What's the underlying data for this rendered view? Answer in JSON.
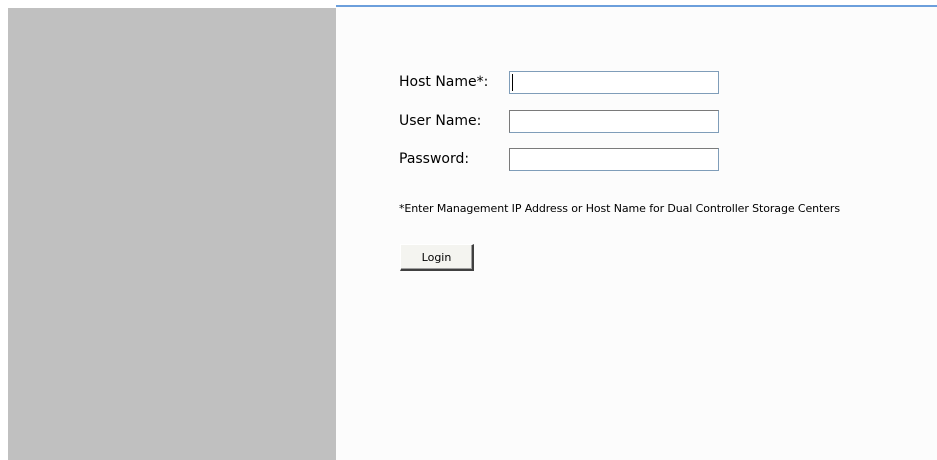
{
  "login_form": {
    "host_name_label": "Host Name*:",
    "host_name_value": "",
    "user_name_label": "User Name:",
    "user_name_value": "",
    "password_label": "Password:",
    "password_value": "",
    "hint_text": "*Enter Management IP Address or Host Name for Dual Controller Storage Centers",
    "login_label": "Login"
  },
  "colors": {
    "left_panel": "#c0c0c0",
    "top_rule": "#6c9fdc",
    "content_background": "#fcfcfc"
  }
}
